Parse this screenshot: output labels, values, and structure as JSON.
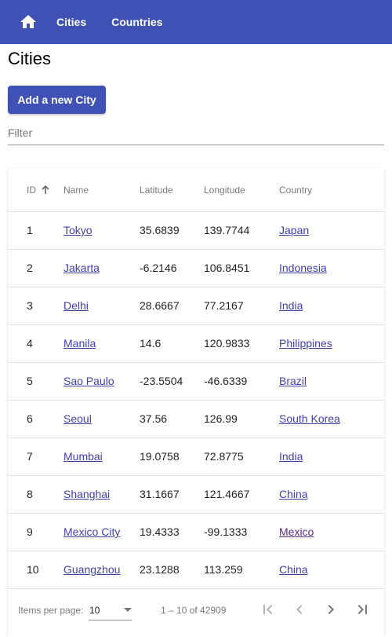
{
  "toolbar": {
    "home_icon": "home-icon",
    "nav_cities": "Cities",
    "nav_countries": "Countries",
    "color": "#3f51b5"
  },
  "page": {
    "title": "Cities",
    "add_button": "Add a new City",
    "filter_placeholder": "Filter"
  },
  "table": {
    "headers": {
      "id": "ID",
      "name": "Name",
      "latitude": "Latitude",
      "longitude": "Longitude",
      "country": "Country"
    },
    "sort_column": "id",
    "sort_direction": "ascending",
    "rows": [
      {
        "id": "1",
        "name": "Tokyo",
        "lat": "35.6839",
        "lon": "139.7744",
        "country": "Japan"
      },
      {
        "id": "2",
        "name": "Jakarta",
        "lat": "-6.2146",
        "lon": "106.8451",
        "country": "Indonesia"
      },
      {
        "id": "3",
        "name": "Delhi",
        "lat": "28.6667",
        "lon": "77.2167",
        "country": "India"
      },
      {
        "id": "4",
        "name": "Manila",
        "lat": "14.6",
        "lon": "120.9833",
        "country": "Philippines"
      },
      {
        "id": "5",
        "name": "Sao Paulo",
        "lat": "-23.5504",
        "lon": "-46.6339",
        "country": "Brazil"
      },
      {
        "id": "6",
        "name": "Seoul",
        "lat": "37.56",
        "lon": "126.99",
        "country": "South Korea"
      },
      {
        "id": "7",
        "name": "Mumbai",
        "lat": "19.0758",
        "lon": "72.8775",
        "country": "India"
      },
      {
        "id": "8",
        "name": "Shanghai",
        "lat": "31.1667",
        "lon": "121.4667",
        "country": "China"
      },
      {
        "id": "9",
        "name": "Mexico City",
        "lat": "19.4333",
        "lon": "-99.1333",
        "country": "Mexico"
      },
      {
        "id": "10",
        "name": "Guangzhou",
        "lat": "23.1288",
        "lon": "113.259",
        "country": "China"
      }
    ]
  },
  "paginator": {
    "items_per_page_label": "Items per page:",
    "items_per_page_value": "10",
    "range_label": "1 – 10 of 42909",
    "first_icon": "first-page-icon",
    "prev_icon": "chevron-left-icon",
    "next_icon": "chevron-right-icon",
    "last_icon": "last-page-icon"
  }
}
